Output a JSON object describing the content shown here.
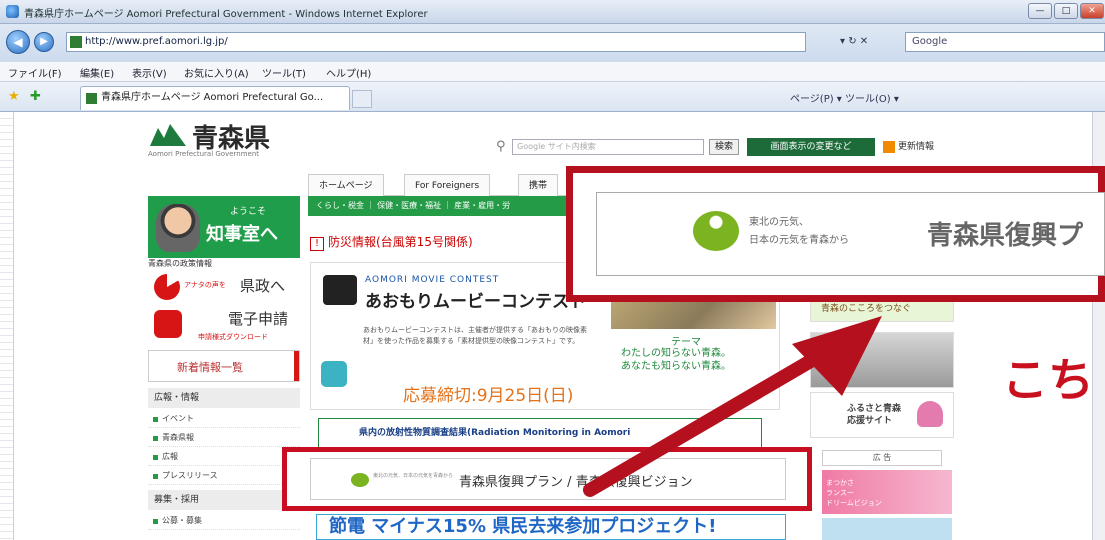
{
  "window": {
    "title": "青森県庁ホームページ Aomori Prefectural Government - Windows Internet Explorer",
    "controls": [
      "—",
      "□",
      "✕"
    ]
  },
  "address": {
    "url": "http://www.pref.aomori.lg.jp/",
    "search_placeholder": "Google",
    "controls": "▾ ↻ ✕"
  },
  "menu": {
    "items": [
      "ファイル(F)",
      "編集(E)",
      "表示(V)",
      "お気に入り(A)",
      "ツール(T)",
      "ヘルプ(H)"
    ]
  },
  "tabs": {
    "active_label": "青森県庁ホームページ Aomori Prefectural Go...",
    "commands": "ページ(P) ▾  ツール(O) ▾"
  },
  "site": {
    "logo_text": "青森県",
    "logo_sub": "Aomori Prefectural Government",
    "search_placeholder": "Google サイト内検索",
    "search_button": "検索",
    "display_button": "画面表示の変更など",
    "rss_label": "更新情報",
    "topnav": [
      "ホームページ",
      "For Foreigners",
      "携帯"
    ],
    "greennav": "くらし・税金 ｜ 保健・医療・福祉 ｜ 産業・雇用・労"
  },
  "sidebar": {
    "welcome": "ようこそ",
    "governor_link": "知事室へ",
    "gov_info": "青森県の政策情報",
    "voice_small": "アナタの声を",
    "voice_big": "県政へ",
    "eapp_big": "電子申請",
    "eapp_small": "申請様式ダウンロード",
    "new_arrivals": "新着情報一覧",
    "sections": [
      {
        "head": "広報・情報",
        "items": [
          "イベント",
          "青森県報",
          "広報",
          "プレスリリース"
        ]
      },
      {
        "head": "募集・採用",
        "items": [
          "公募・募集"
        ]
      }
    ]
  },
  "main": {
    "disaster": "防災情報(台風第15号関係)",
    "movie_en": "AOMORI MOVIE CONTEST",
    "movie_jp": "あおもりムービーコンテスト",
    "movie_desc": "あおもりムービーコンテストは、主催者が提供する「あおもりの映像素材」を使った作品を募集する「素材提供型の映像コンテスト」です。",
    "movie_theme_head": "テーマ",
    "movie_theme": "わたしの知らない青森。\nあなたも知らない青森。",
    "movie_deadline": "応募締切:9月25日(日)",
    "radiation": "県内の放射性物質調査結果(Radiation Monitoring in Aomori",
    "plan_small": "東北の元気、日本の元気を青森から",
    "plan_label": "青森県復興プラン / 青森県復興ビジョン",
    "setsuden": "節電 マイナス15% 県民去来参加プロジェクト!"
  },
  "right": {
    "banner1": "青森のこころをつなぐ",
    "banner3": "ふるさと青森\n応援サイト",
    "ad_label": "広 告",
    "banner4": "まつかさ\nランスー\nドリームビジョン"
  },
  "callout": {
    "slogan1": "東北の元気、",
    "slogan2": "日本の元気を青森から",
    "big": "青森県復興プ",
    "annotation": "こち"
  }
}
